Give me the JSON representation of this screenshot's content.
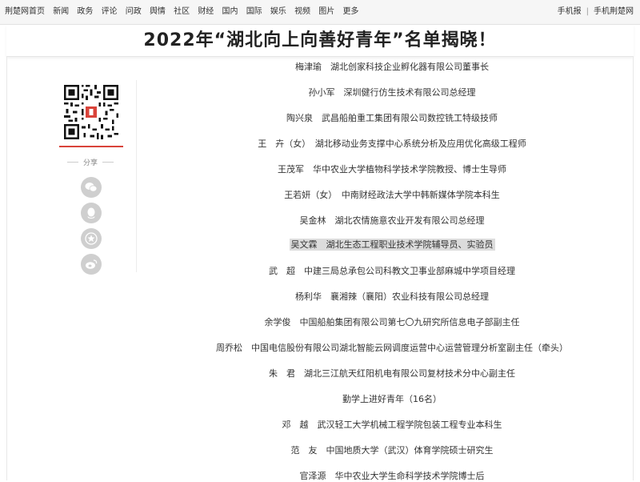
{
  "topnav": {
    "items": [
      "荆楚网首页",
      "新闻",
      "政务",
      "评论",
      "问政",
      "舆情",
      "社区",
      "财经",
      "国内",
      "国际",
      "娱乐",
      "视频",
      "图片",
      "更多"
    ],
    "right": [
      "手机报",
      "手机荆楚网"
    ],
    "separator": "|"
  },
  "article": {
    "title": "2022年“湖北向上向善好青年”名单揭晓！"
  },
  "sidebar": {
    "share_label": "分享",
    "share_icons": [
      "wechat-icon",
      "qq-icon",
      "favorite-star-icon",
      "weibo-icon"
    ]
  },
  "list": [
    "梅津瑜　湖北创家科技企业孵化器有限公司董事长",
    "孙小军　深圳健行仿生技术有限公司总经理",
    "陶兴泉　武昌船舶重工集团有限公司数控铣工特级技师",
    "王　卉（女）　湖北移动业务支撑中心系统分析及应用优化高级工程师",
    "王茂军　华中农业大学植物科学技术学院教授、博士生导师",
    "王若妍（女）　中南财经政法大学中韩新媒体学院本科生",
    "吴金林　湖北农情施意农业开发有限公司总经理",
    "吴文霖　湖北生态工程职业技术学院辅导员、实验员",
    "武　超　中建三局总承包公司科教文卫事业部麻城中学项目经理",
    "杨利华　襄湘辣（襄阳）农业科技有限公司总经理",
    "余学俊　中国船舶集团有限公司第七〇九研究所信息电子部副主任",
    "周乔松　中国电信股份有限公司湖北智能云网调度运营中心运营管理分析室副主任（牵头）",
    "朱　君　湖北三江航天红阳机电有限公司复材技术分中心副主任",
    "勤学上进好青年（16名）",
    "邓　越　武汉轻工大学机械工程学院包装工程专业本科生",
    "范　友　中国地质大学（武汉）体育学院硕士研究生",
    "官泽源　华中农业大学生命科学技术学院博士后"
  ],
  "highlighted_index": 7
}
